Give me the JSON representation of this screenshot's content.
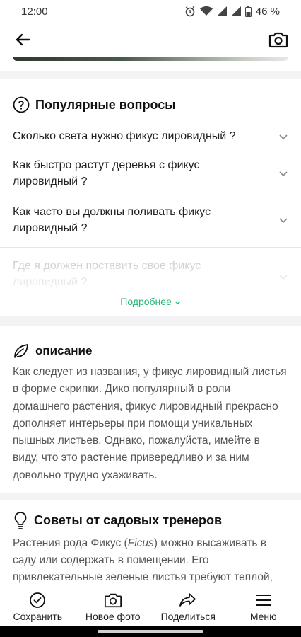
{
  "status_bar": {
    "time": "12:00",
    "battery": "46 %"
  },
  "faq": {
    "title": "Популярные вопросы",
    "items": [
      {
        "question": "Сколько света нужно фикус лировидный ?"
      },
      {
        "question": "Как быстро растут деревья с фикус лировидный ?"
      },
      {
        "question": "Как часто вы должны поливать фикус лировидный ?"
      },
      {
        "question": "Где я должен поставить свое фикус лировидный ?"
      }
    ],
    "more_label": "Подробнее"
  },
  "description": {
    "title": "описание",
    "text": "Как следует из названия, у фикус лировидный листья в форме скрипки. Дико популярный в роли домашнего растения, фикус лировидный прекрасно дополняет интерьеры при помощи уникальных пышных листьев. Однако, пожалуйста, имейте в виду, что это растение привередливо и за ним довольно трудно ухаживать."
  },
  "tips": {
    "title": "Советы от садовых тренеров",
    "text_before": "Растения рода Фикус (",
    "text_italic": "Ficus",
    "text_after": ") можно высаживать в саду или содержать в помещении. Его привлекательные зеленые листья требуют теплой, влажной среды; в целом, за этим растением не так"
  },
  "bottom_nav": [
    {
      "label": "Сохранить",
      "icon": "check-circle-icon"
    },
    {
      "label": "Новое фото",
      "icon": "camera-icon"
    },
    {
      "label": "Поделиться",
      "icon": "share-icon"
    },
    {
      "label": "Меню",
      "icon": "menu-icon"
    }
  ],
  "colors": {
    "accent": "#22b573",
    "band": "#f2f3f5"
  }
}
